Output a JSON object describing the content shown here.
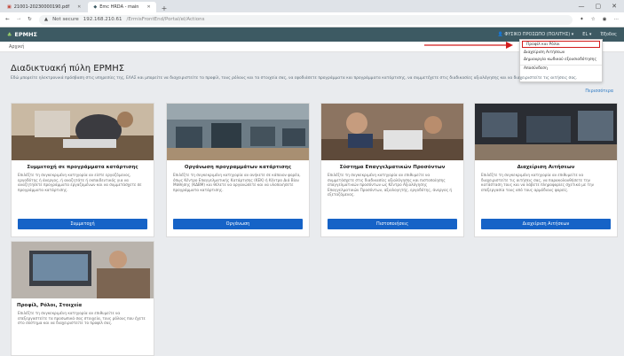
{
  "browser": {
    "tabs": [
      {
        "title": "21001-20230000190.pdf"
      },
      {
        "title": "Emc HRDA - main"
      }
    ],
    "not_secure": "Not secure",
    "address": "192.168.210.61",
    "address_path": "/ErmisFrontEnd/Portal/el/Actions"
  },
  "app": {
    "brand": "ΕΡΜΗΣ",
    "user_menu": "ΦΥΣΙΚΟ ΠΡΟΣΩΠΟ (ΠΟΛΙΤΗΣ)",
    "lang": "EL",
    "exit": "Έξοδος"
  },
  "breadcrumb": "Αρχική",
  "dropdown": {
    "items": [
      "Προφίλ και Ρόλοι",
      "Διαχείριση Αιτήσεων",
      "Δημιουργία κωδικού εξουσιοδότησης",
      "Αποσύνδεση"
    ]
  },
  "page": {
    "title": "Διαδικτυακή πύλη ΕΡΜΗΣ",
    "intro": "Εδώ μπορείτε ηλεκτρονικά πρόσβαση στις υπηρεσίες της, ΕΛΑΣ και μπορείτε να διαχειριστείτε το προφίλ, τους ρόλους και τα στοιχεία σας, να εφοδιάσετε προγράμματα και προγράμματα κατάρτισης, να συμμετέχετε στις διαδικασίες αξιολόγησης και να διαχειριστείτε τις αιτήσεις σας.",
    "more_link": "Περισσότερα"
  },
  "cards": [
    {
      "title": "Συμμετοχή σε προγράμματα κατάρτισης",
      "text": "Επιλέξτε τη συγκεκριμένη κατηγορία αν είστε εργαζόμενος, εργοδότης ή άνεργος, ή αναζητάτε ή εκπαιδευτικός για να αναζητήσετε προγράμματα εργαζομένων και να συμμετάσχετε σε προγράμματα κατάρτισης.",
      "button": "Συμμετοχή"
    },
    {
      "title": "Οργάνωση προγραμμάτων κατάρτισης",
      "text": "Επιλέξτε τη συγκεκριμένη κατηγορία αν ανήκετε σε κάποιον φορέα, όπως Κέντρο Επαγγελματικής Κατάρτισης (ΚΕΚ) ή Κέντρο Διά Βίου Μάθησης (ΚΔΒΜ) και θέλετε να οργανώσετε και να υλοποιήσετε προγράμματα κατάρτισης.",
      "button": "Οργάνωση"
    },
    {
      "title": "Σύστημα Επαγγελματικών Προσόντων",
      "text": "Επιλέξτε τη συγκεκριμένη κατηγορία αν επιθυμείτε να συμμετάσχετε στις διαδικασίες αξιολόγησης και πιστοποίησης επαγγελματικών προσόντων ως Κέντρο Αξιολόγησης Επαγγελματικών Προσόντων, αξιολογητής, εργοδότης, άνεργος ή εξεταζόμενος.",
      "button": "Πιστοποιήσεις"
    },
    {
      "title": "Διαχείριση Αιτήσεων",
      "text": "Επιλέξτε τη συγκεκριμένη κατηγορία αν επιθυμείτε να διαχειριστείτε τις αιτήσεις σας, να παρακολουθήσετε την κατάσταση τους και να λάβετε πληροφορίες σχετικά με την επεξεργασία τους από τους αρμόδιους φορείς.",
      "button": "Διαχείριση Αιτήσεων"
    },
    {
      "title": "Προφίλ, Ρόλοι, Στοιχεία",
      "text": "Επιλέξτε τη συγκεκριμένη κατηγορία αν επιθυμείτε να επεξεργαστείτε τα προσωπικά σας στοιχεία, τους ρόλους που έχετε στο σύστημα και να διαχειριστείτε το προφίλ σας.",
      "button": ""
    }
  ]
}
